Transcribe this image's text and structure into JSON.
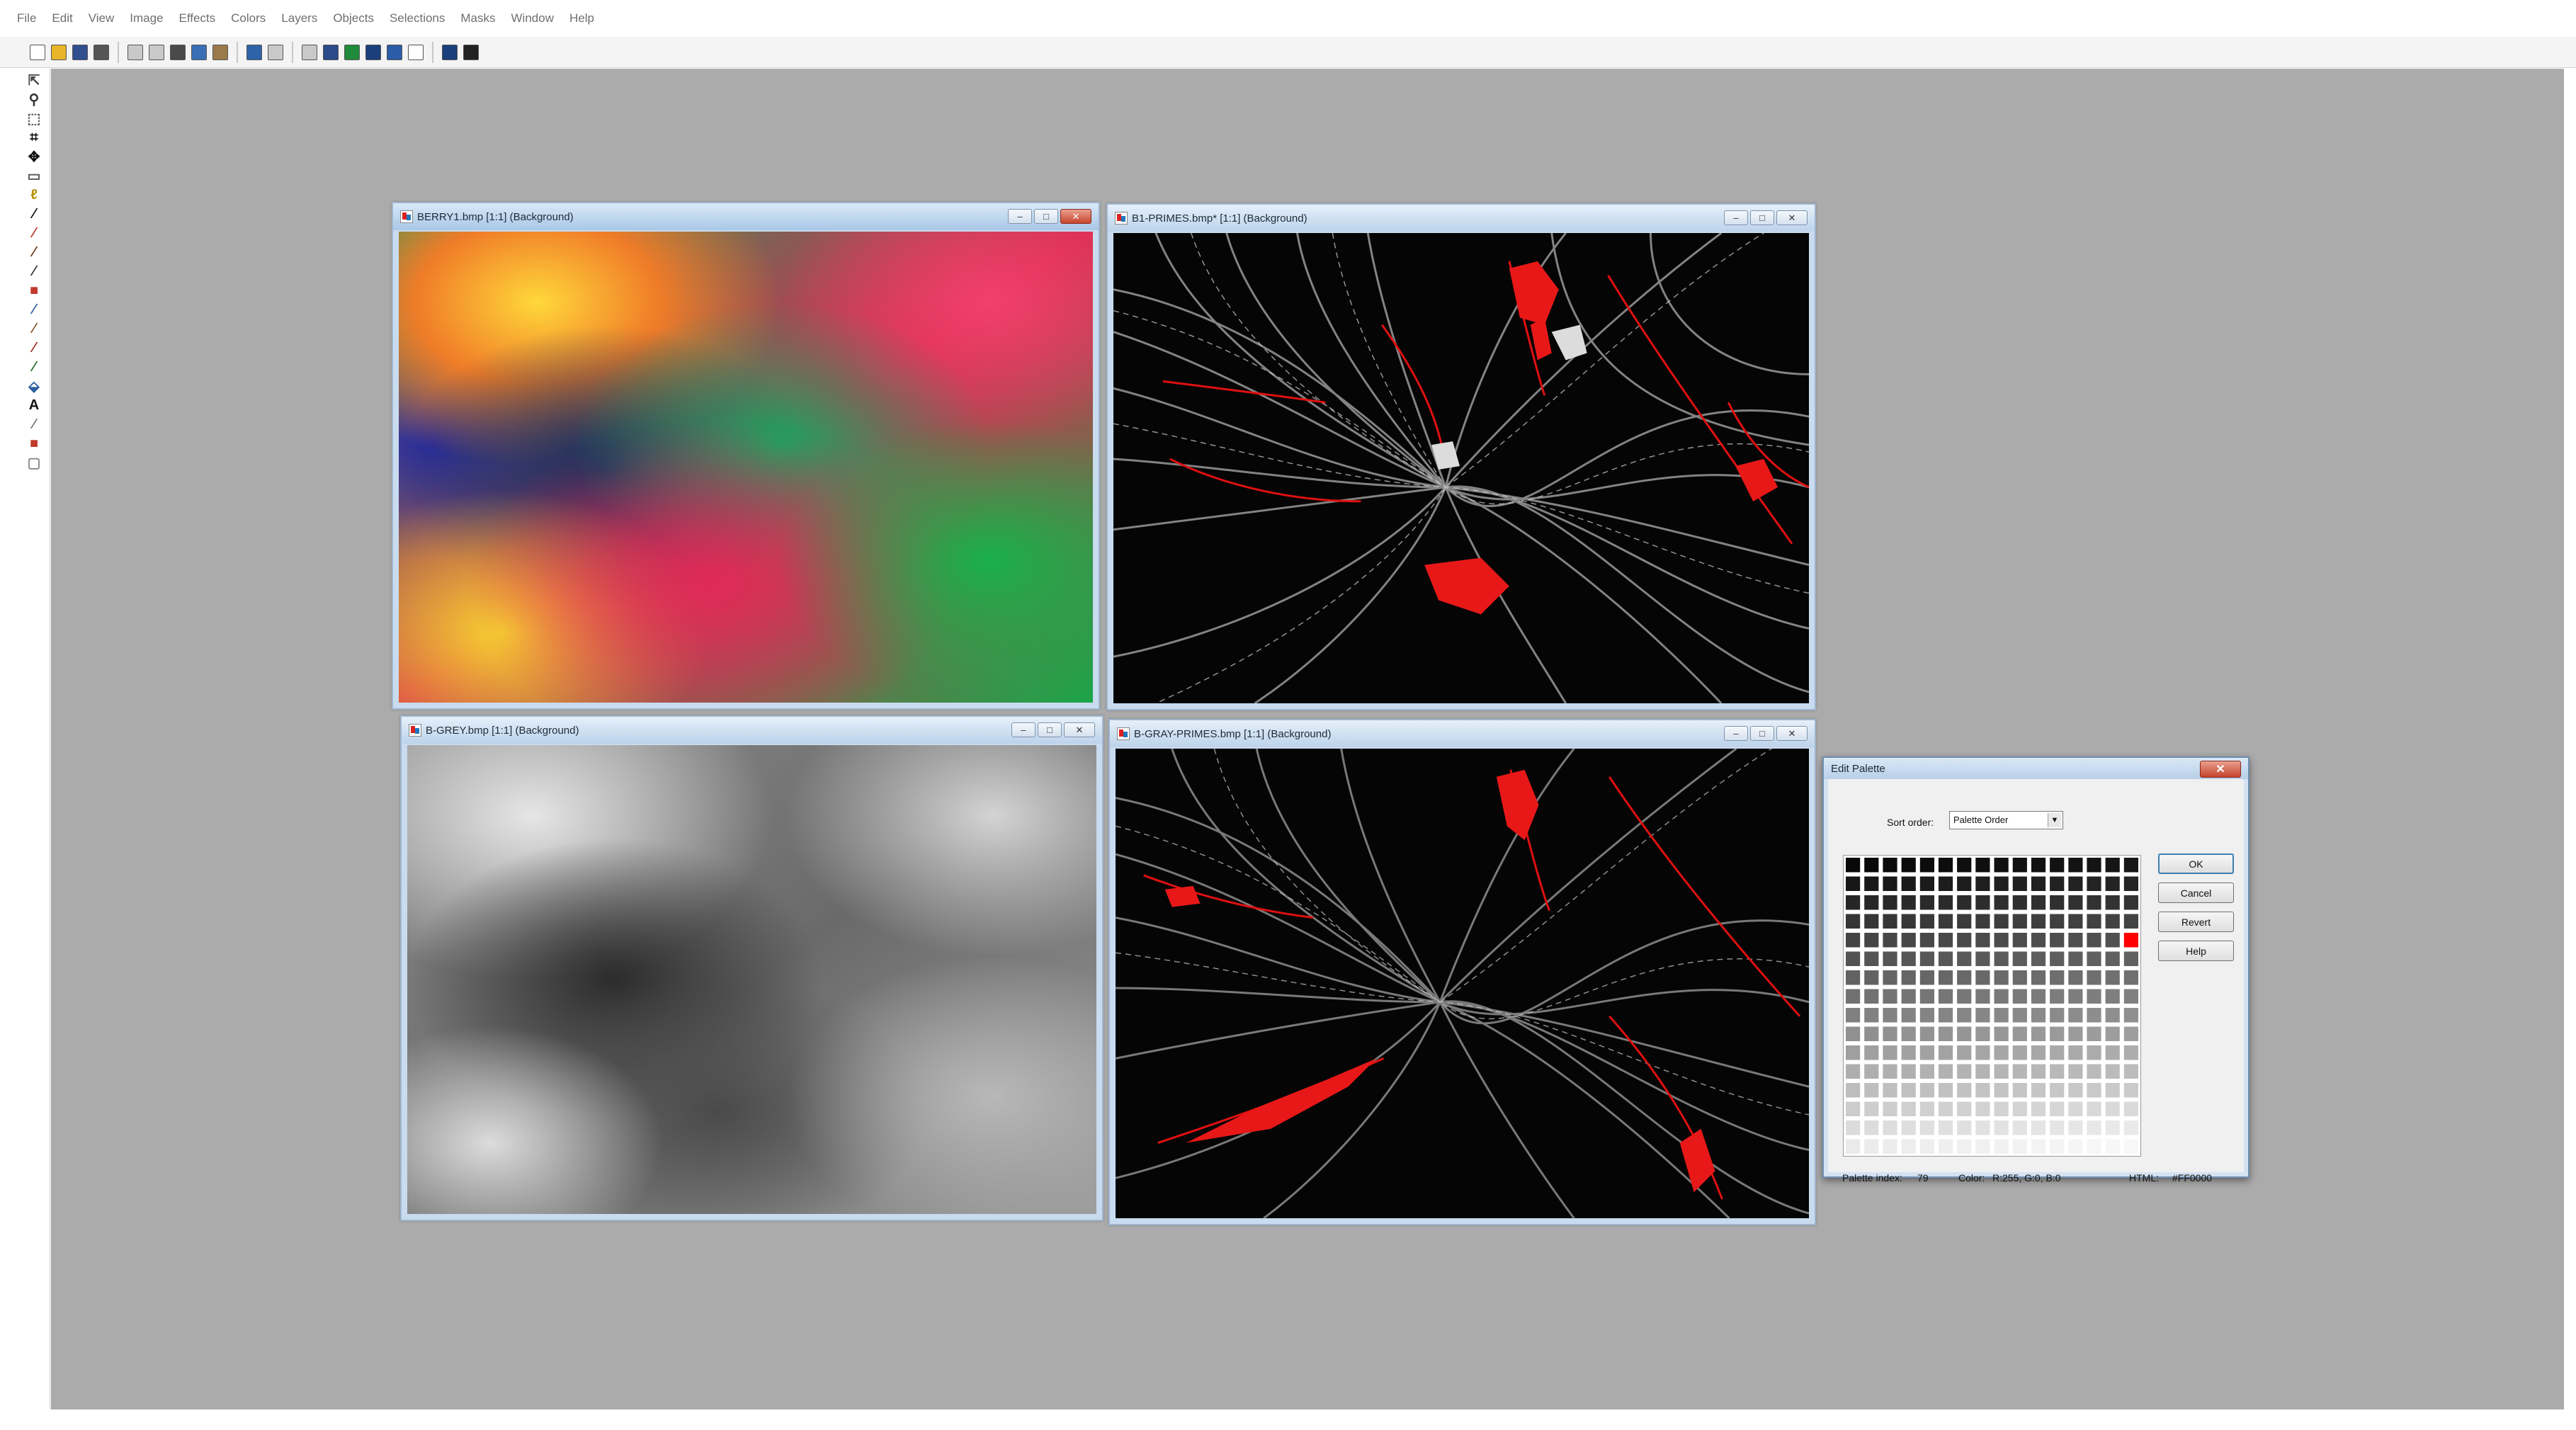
{
  "menu": [
    "File",
    "Edit",
    "View",
    "Image",
    "Effects",
    "Colors",
    "Layers",
    "Objects",
    "Selections",
    "Masks",
    "Window",
    "Help"
  ],
  "toolbar": {
    "groups": [
      [
        {
          "icon": "new-icon",
          "color": "#ffffff"
        },
        {
          "icon": "open-icon",
          "color": "#e7b42a"
        },
        {
          "icon": "save-icon",
          "color": "#304f8e"
        },
        {
          "icon": "print-icon",
          "color": "#555555"
        }
      ],
      [
        {
          "icon": "undo-icon",
          "color": "#c9c9c9"
        },
        {
          "icon": "redo-icon",
          "color": "#c9c9c9"
        },
        {
          "icon": "cut-icon",
          "color": "#4a4a4a"
        },
        {
          "icon": "copy-icon",
          "color": "#3a6fb5"
        },
        {
          "icon": "paste-icon",
          "color": "#9b7a4a"
        }
      ],
      [
        {
          "icon": "browse-icon",
          "color": "#2e63a8"
        },
        {
          "icon": "capture-icon",
          "color": "#c9c9c9"
        }
      ],
      [
        {
          "icon": "zoom-in-icon",
          "color": "#c9c9c9"
        },
        {
          "icon": "tool-palette-icon",
          "color": "#2a4a8a"
        },
        {
          "icon": "color-palette-icon",
          "color": "#1f8a3a"
        },
        {
          "icon": "layer-palette-icon",
          "color": "#1b3f7a"
        },
        {
          "icon": "overview-icon",
          "color": "#2b5ca8"
        },
        {
          "icon": "histogram-icon",
          "color": "#ffffff"
        }
      ],
      [
        {
          "icon": "help-icon",
          "color": "#1b3f7a"
        },
        {
          "icon": "about-icon",
          "color": "#222222"
        }
      ]
    ]
  },
  "tools": [
    {
      "icon": "arrow-icon",
      "glyph": "⇱",
      "color": "#444444"
    },
    {
      "icon": "zoom-icon",
      "glyph": "⚲",
      "color": "#333333"
    },
    {
      "icon": "deformation-icon",
      "glyph": "⬚",
      "color": "#555555"
    },
    {
      "icon": "crop-icon",
      "glyph": "⌗",
      "color": "#111111"
    },
    {
      "icon": "mover-icon",
      "glyph": "✥",
      "color": "#111111"
    },
    {
      "icon": "selection-icon",
      "glyph": "▭",
      "color": "#555555"
    },
    {
      "icon": "freehand-icon",
      "glyph": "ℓ",
      "color": "#b8920a"
    },
    {
      "icon": "magic-wand-icon",
      "glyph": "⁄",
      "color": "#111111"
    },
    {
      "icon": "dropper-icon",
      "glyph": "⁄",
      "color": "#c0392b"
    },
    {
      "icon": "paintbrush-icon",
      "glyph": "⁄",
      "color": "#6b3a16"
    },
    {
      "icon": "clone-brush-icon",
      "glyph": "⁄",
      "color": "#333333"
    },
    {
      "icon": "color-replacer-icon",
      "glyph": "■",
      "color": "#c0392b"
    },
    {
      "icon": "retouch-icon",
      "glyph": "⁄",
      "color": "#355f9e"
    },
    {
      "icon": "eraser-icon",
      "glyph": "⁄",
      "color": "#8a5a2a"
    },
    {
      "icon": "picture-tube-icon",
      "glyph": "⁄",
      "color": "#a0322b"
    },
    {
      "icon": "airbrush-icon",
      "glyph": "⁄",
      "color": "#2a6a2a"
    },
    {
      "icon": "flood-fill-icon",
      "glyph": "⬙",
      "color": "#2d5fa0"
    },
    {
      "icon": "text-icon",
      "glyph": "A",
      "color": "#111111"
    },
    {
      "icon": "draw-icon",
      "glyph": "⁄",
      "color": "#777777"
    },
    {
      "icon": "preset-shapes-icon",
      "glyph": "■",
      "color": "#c0392b"
    },
    {
      "icon": "vector-object-icon",
      "glyph": "▢",
      "color": "#888888"
    }
  ],
  "windows": [
    {
      "id": "berry1",
      "title": "BERRY1.bmp [1:1] (Background)",
      "active": true
    },
    {
      "id": "b1-primes",
      "title": "B1-PRIMES.bmp* [1:1] (Background)",
      "active": false
    },
    {
      "id": "b-grey",
      "title": "B-GREY.bmp [1:1] (Background)",
      "active": false
    },
    {
      "id": "b-gray-primes",
      "title": "B-GRAY-PRIMES.bmp [1:1] (Background)",
      "active": false
    }
  ],
  "caption_glyphs": {
    "minimize": "–",
    "maximize": "□",
    "close": "✕"
  },
  "dialog": {
    "title": "Edit Palette",
    "close_glyph": "✕",
    "sort_label": "Sort order:",
    "sort_value": "Palette Order",
    "buttons": {
      "ok": "OK",
      "cancel": "Cancel",
      "revert": "Revert",
      "help": "Help"
    },
    "palette_index_label": "Palette index:",
    "palette_index": "79",
    "color_label": "Color:",
    "color_value": "R:255, G:0, B:0",
    "html_label": "HTML:",
    "html_value": "#FF0000",
    "selected_color": "#ff0000",
    "selected_index": 79,
    "cols": 16,
    "rows": 16
  }
}
